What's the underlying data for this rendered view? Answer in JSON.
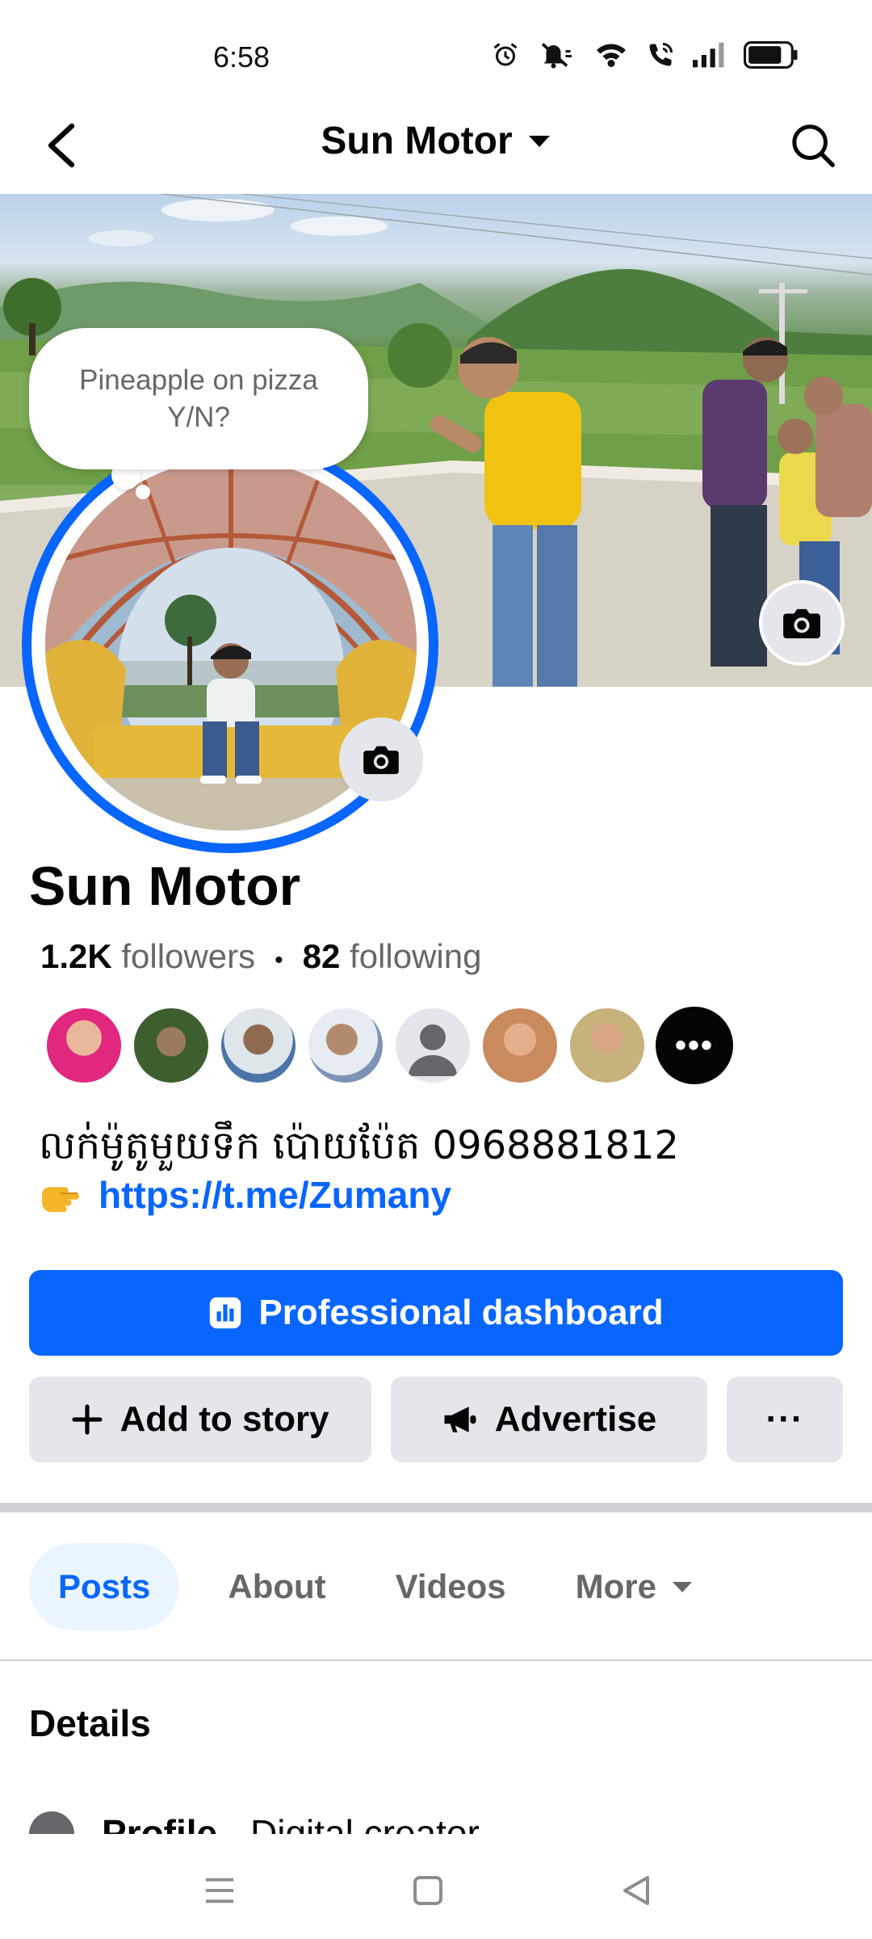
{
  "status_bar": {
    "time": "6:58",
    "icons": [
      "alarm-icon",
      "mute-icon",
      "wifi-icon",
      "wifi-call-icon",
      "signal-icon",
      "battery-icon"
    ]
  },
  "nav": {
    "title": "Sun Motor",
    "icons": [
      "back-arrow-icon",
      "dropdown-caret-icon",
      "search-icon"
    ]
  },
  "note": {
    "text": "Pineapple on pizza Y/N?"
  },
  "profile": {
    "name": "Sun Motor",
    "followers_count": "1.2K",
    "followers_label": "followers",
    "separator": "•",
    "following_count": "82",
    "following_label": "following",
    "friends_more_label": "•••",
    "bio_line1": "លក់ម៉ូតូមួយទឹក ប៉ោយប៉ែត 0968881812",
    "bio_link": "https://t.me/Zumany"
  },
  "buttons": {
    "dashboard": "Professional dashboard",
    "add_story": "Add to story",
    "advertise": "Advertise",
    "more": "···"
  },
  "tabs": [
    {
      "label": "Posts",
      "active": true
    },
    {
      "label": "About",
      "active": false
    },
    {
      "label": "Videos",
      "active": false
    },
    {
      "label": "More",
      "active": false
    }
  ],
  "details": {
    "title": "Details",
    "row_label": "Profile",
    "row_value": " · Digital creator"
  },
  "colors": {
    "accent": "#0866ff",
    "button_gray": "#e4e6eb",
    "secondary_text": "#65676b"
  }
}
